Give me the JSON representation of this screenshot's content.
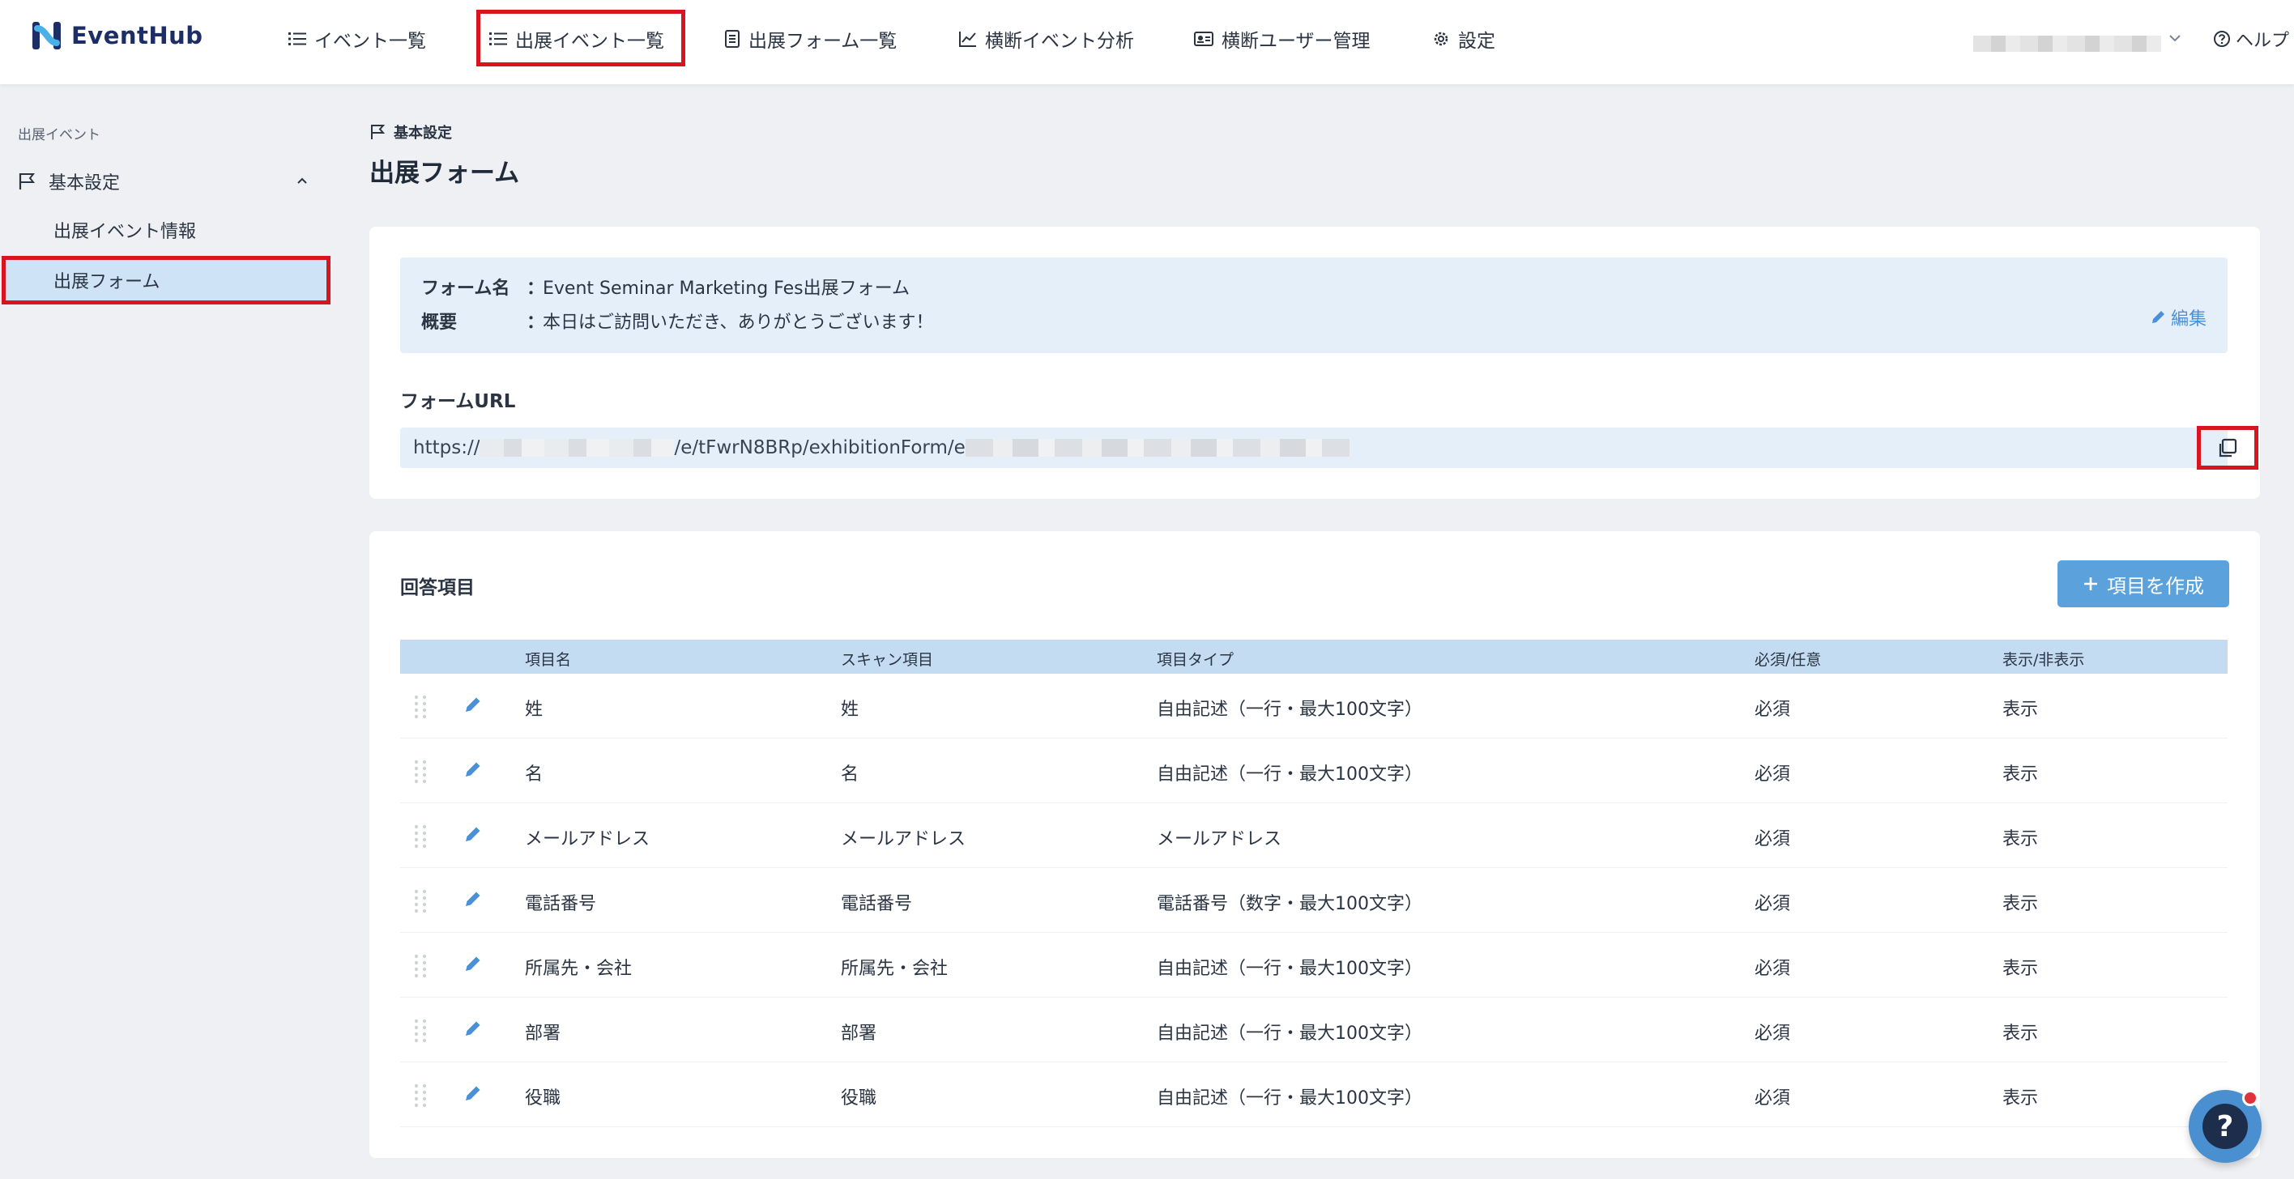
{
  "app": {
    "name": "EventHub"
  },
  "colors": {
    "accent": "#4a90d9",
    "highlight": "#d8151f",
    "button": "#5ba2dc",
    "header_row": "#c4dcf2",
    "info_box": "#e4eff9"
  },
  "nav": {
    "items": [
      {
        "label": "イベント一覧",
        "icon": "list-icon"
      },
      {
        "label": "出展イベント一覧",
        "icon": "list-icon"
      },
      {
        "label": "出展フォーム一覧",
        "icon": "document-icon"
      },
      {
        "label": "横断イベント分析",
        "icon": "chart-icon"
      },
      {
        "label": "横断ユーザー管理",
        "icon": "id-card-icon"
      },
      {
        "label": "設定",
        "icon": "gear-icon"
      }
    ],
    "help_label": "ヘルプ"
  },
  "sidebar": {
    "caption": "出展イベント",
    "group_label": "基本設定",
    "items": [
      {
        "label": "出展イベント情報"
      },
      {
        "label": "出展フォーム"
      }
    ]
  },
  "breadcrumb": "基本設定",
  "page_title": "出展フォーム",
  "form_info": {
    "name_key": "フォーム名",
    "name_value": "Event Seminar Marketing Fes出展フォーム",
    "summary_key": "概要",
    "summary_value": "本日はご訪問いただき、ありがとうございます！",
    "separator": "：",
    "edit_label": "編集"
  },
  "form_url": {
    "label": "フォームURL",
    "prefix": "https://",
    "middle": "/e/tFwrN8BRp/exhibitionForm/e"
  },
  "answers": {
    "title": "回答項目",
    "add_button": "項目を作成",
    "columns": [
      "項目名",
      "スキャン項目",
      "項目タイプ",
      "必須/任意",
      "表示/非表示"
    ],
    "rows": [
      [
        "姓",
        "姓",
        "自由記述（一行・最大100文字）",
        "必須",
        "表示"
      ],
      [
        "名",
        "名",
        "自由記述（一行・最大100文字）",
        "必須",
        "表示"
      ],
      [
        "メールアドレス",
        "メールアドレス",
        "メールアドレス",
        "必須",
        "表示"
      ],
      [
        "電話番号",
        "電話番号",
        "電話番号（数字・最大100文字）",
        "必須",
        "表示"
      ],
      [
        "所属先・会社",
        "所属先・会社",
        "自由記述（一行・最大100文字）",
        "必須",
        "表示"
      ],
      [
        "部署",
        "部署",
        "自由記述（一行・最大100文字）",
        "必須",
        "表示"
      ],
      [
        "役職",
        "役職",
        "自由記述（一行・最大100文字）",
        "必須",
        "表示"
      ]
    ]
  },
  "help_fab": {
    "glyph": "?"
  }
}
